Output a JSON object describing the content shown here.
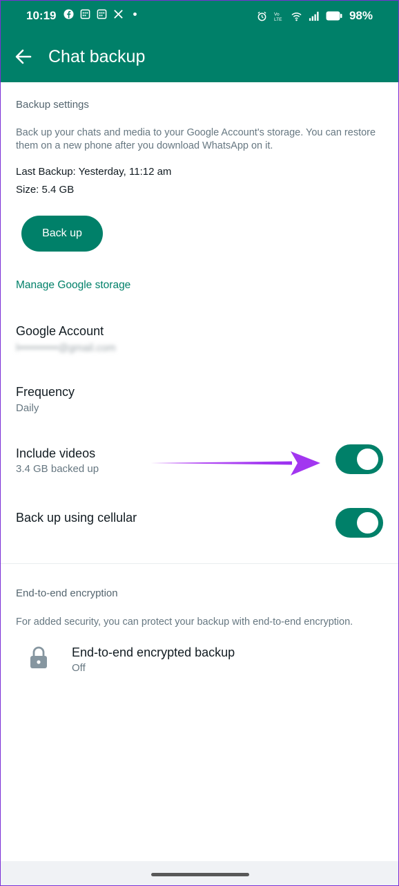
{
  "status_bar": {
    "time": "10:19",
    "battery_percent": "98%",
    "left_icons": [
      "facebook-icon",
      "calendar-icon",
      "calendar-icon",
      "x-icon",
      "dot-icon"
    ],
    "right_icons": [
      "alarm-icon",
      "volte-icon",
      "wifi-icon",
      "signal-icon",
      "battery-icon"
    ]
  },
  "app_bar": {
    "title": "Chat backup",
    "back_icon": "arrow-left-icon"
  },
  "backup_settings": {
    "heading": "Backup settings",
    "description": "Back up your chats and media to your Google Account's storage. You can restore them on a new phone after you download WhatsApp on it.",
    "last_backup": "Last Backup: Yesterday, 11:12 am",
    "size": "Size: 5.4 GB",
    "backup_button": "Back up",
    "manage_link": "Manage Google storage"
  },
  "settings_rows": {
    "google_account": {
      "title": "Google Account",
      "value": "l•••••••••••@gmail.com"
    },
    "frequency": {
      "title": "Frequency",
      "value": "Daily"
    },
    "include_videos": {
      "title": "Include videos",
      "value": "3.4 GB backed up",
      "enabled": true
    },
    "cellular": {
      "title": "Back up using cellular",
      "enabled": true
    }
  },
  "encryption": {
    "heading": "End-to-end encryption",
    "description": "For added security, you can protect your backup with end-to-end encryption.",
    "item_title": "End-to-end encrypted backup",
    "item_value": "Off",
    "icon": "lock-icon"
  },
  "annotation": {
    "arrow_color": "#a236f0"
  },
  "colors": {
    "accent": "#008069",
    "background": "#ffffff"
  }
}
